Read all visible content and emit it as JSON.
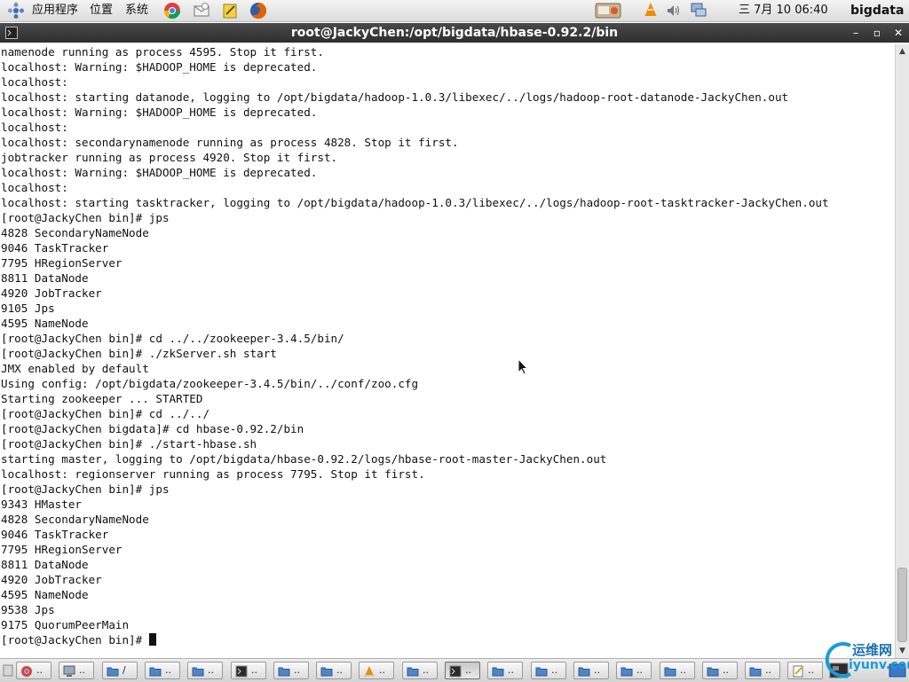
{
  "top_panel": {
    "menus": [
      "应用程序",
      "位置",
      "系统"
    ],
    "clock": "三 7月 10 06:40",
    "user": "bigdata",
    "launchers": [
      "chrome-icon",
      "mail-icon",
      "notes-icon",
      "firefox-icon"
    ],
    "tray": [
      "network-icon",
      "vlc-icon",
      "volume-icon",
      "display-icon"
    ]
  },
  "window": {
    "title": "root@JackyChen:/opt/bigdata/hbase-0.92.2/bin"
  },
  "terminal": {
    "lines": [
      "namenode running as process 4595. Stop it first.",
      "localhost: Warning: $HADOOP_HOME is deprecated.",
      "localhost:",
      "localhost: starting datanode, logging to /opt/bigdata/hadoop-1.0.3/libexec/../logs/hadoop-root-datanode-JackyChen.out",
      "localhost: Warning: $HADOOP_HOME is deprecated.",
      "localhost:",
      "localhost: secondarynamenode running as process 4828. Stop it first.",
      "jobtracker running as process 4920. Stop it first.",
      "localhost: Warning: $HADOOP_HOME is deprecated.",
      "localhost:",
      "localhost: starting tasktracker, logging to /opt/bigdata/hadoop-1.0.3/libexec/../logs/hadoop-root-tasktracker-JackyChen.out",
      "[root@JackyChen bin]# jps",
      "4828 SecondaryNameNode",
      "9046 TaskTracker",
      "7795 HRegionServer",
      "8811 DataNode",
      "4920 JobTracker",
      "9105 Jps",
      "4595 NameNode",
      "[root@JackyChen bin]# cd ../../zookeeper-3.4.5/bin/",
      "[root@JackyChen bin]# ./zkServer.sh start",
      "JMX enabled by default",
      "Using config: /opt/bigdata/zookeeper-3.4.5/bin/../conf/zoo.cfg",
      "Starting zookeeper ... STARTED",
      "[root@JackyChen bin]# cd ../../",
      "[root@JackyChen bigdata]# cd hbase-0.92.2/bin",
      "[root@JackyChen bin]# ./start-hbase.sh",
      "starting master, logging to /opt/bigdata/hbase-0.92.2/logs/hbase-root-master-JackyChen.out",
      "localhost: regionserver running as process 7795. Stop it first.",
      "[root@JackyChen bin]# jps",
      "9343 HMaster",
      "4828 SecondaryNameNode",
      "9046 TaskTracker",
      "7795 HRegionServer",
      "8811 DataNode",
      "4920 JobTracker",
      "4595 NameNode",
      "9538 Jps",
      "9175 QuorumPeerMain"
    ],
    "prompt": "[root@JackyChen bin]# "
  },
  "taskbar": {
    "items": [
      {
        "label": "..",
        "icon": "chrome-icon"
      },
      {
        "label": "..",
        "icon": "computer-icon"
      },
      {
        "label": "/",
        "icon": "folder-icon"
      },
      {
        "label": "..",
        "icon": "folder-icon"
      },
      {
        "label": "..",
        "icon": "folder-icon"
      },
      {
        "label": "..",
        "icon": "terminal-icon"
      },
      {
        "label": "..",
        "icon": "folder-icon"
      },
      {
        "label": "..",
        "icon": "folder-icon"
      },
      {
        "label": "..",
        "icon": "vlc-icon"
      },
      {
        "label": "..",
        "icon": "folder-icon"
      },
      {
        "label": "..",
        "icon": "terminal-icon",
        "active": true
      },
      {
        "label": "..",
        "icon": "folder-icon"
      },
      {
        "label": "..",
        "icon": "folder-icon"
      },
      {
        "label": "..",
        "icon": "folder-icon"
      },
      {
        "label": "..",
        "icon": "folder-icon"
      },
      {
        "label": "..",
        "icon": "folder-icon"
      },
      {
        "label": "..",
        "icon": "folder-icon"
      },
      {
        "label": "..",
        "icon": "folder-icon"
      },
      {
        "label": "..",
        "icon": "edit-icon"
      }
    ]
  },
  "watermark": {
    "text": "运维网",
    "sub": "iyunv.com"
  },
  "colors": {
    "panel": "#dcdcdc",
    "titlebar": "#2e2e2e",
    "folder": "#3a6fb0",
    "firefox": "#e66000"
  }
}
